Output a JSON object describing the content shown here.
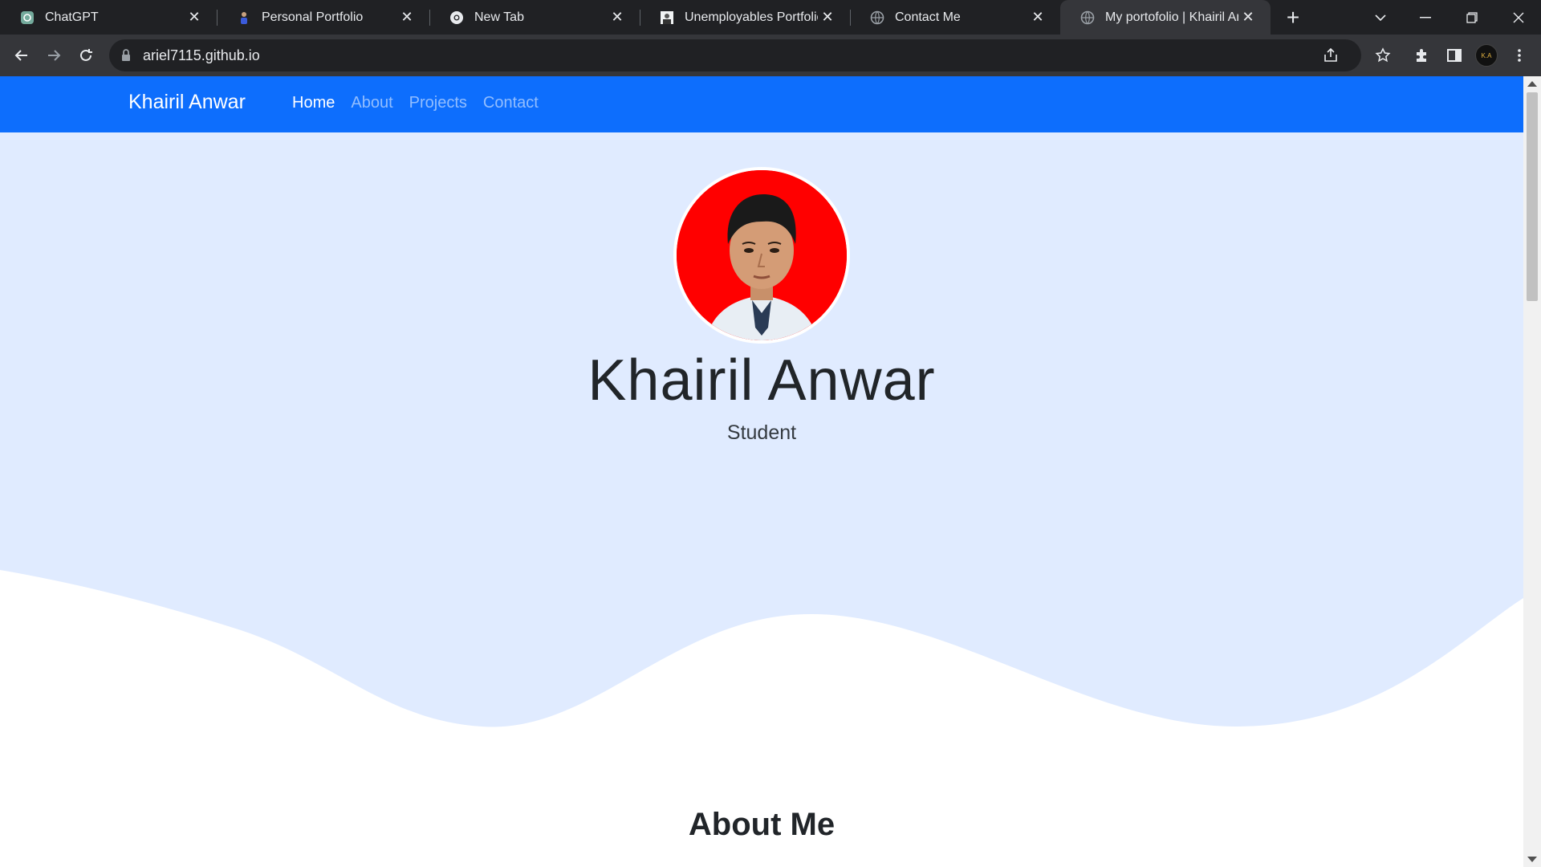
{
  "browser": {
    "tabs": [
      {
        "title": "ChatGPT",
        "icon": "chatgpt-icon",
        "active": false
      },
      {
        "title": "Personal Portfolio",
        "icon": "person-icon",
        "active": false
      },
      {
        "title": "New Tab",
        "icon": "chrome-icon",
        "active": false
      },
      {
        "title": "Unemployables Portfolio",
        "icon": "portrait-icon",
        "active": false
      },
      {
        "title": "Contact Me",
        "icon": "globe-icon",
        "active": false
      },
      {
        "title": "My portofolio | Khairil Anwar",
        "icon": "globe-icon",
        "active": true
      }
    ],
    "url": "ariel7115.github.io",
    "profile_initials": "K.A"
  },
  "site": {
    "brand": "Khairil Anwar",
    "nav": [
      {
        "label": "Home",
        "active": true
      },
      {
        "label": "About",
        "active": false
      },
      {
        "label": "Projects",
        "active": false
      },
      {
        "label": "Contact",
        "active": false
      }
    ],
    "hero": {
      "name": "Khairil Anwar",
      "role": "Student"
    },
    "about_title": "About Me"
  },
  "colors": {
    "navbar": "#0d6efd",
    "hero_bg": "#e0ebff",
    "chrome_dark": "#202124",
    "chrome_toolbar": "#35363a"
  }
}
